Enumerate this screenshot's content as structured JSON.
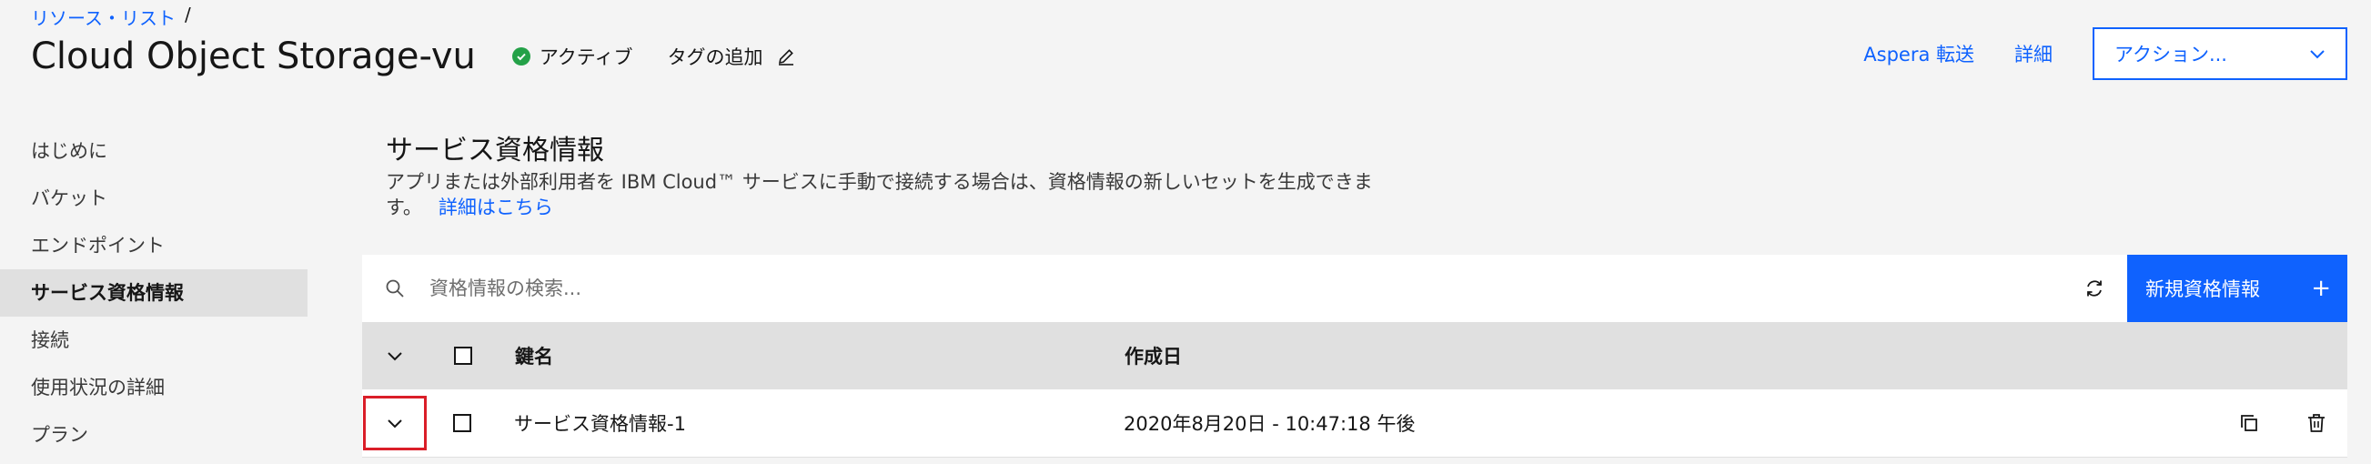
{
  "breadcrumb": {
    "link": "リソース・リスト",
    "separator": "/"
  },
  "header": {
    "title": "Cloud Object Storage-vu",
    "status": "アクティブ",
    "add_tag": "タグの追加",
    "aspera_link": "Aspera 転送",
    "details_link": "詳細",
    "actions_select": "アクション..."
  },
  "sidebar": {
    "items": [
      {
        "label": "はじめに"
      },
      {
        "label": "バケット"
      },
      {
        "label": "エンドポイント"
      },
      {
        "label": "サービス資格情報"
      },
      {
        "label": "接続"
      },
      {
        "label": "使用状況の詳細"
      },
      {
        "label": "プラン"
      }
    ],
    "active_index": 3
  },
  "section": {
    "title": "サービス資格情報",
    "description": "アプリまたは外部利用者を IBM Cloud™ サービスに手動で接続する場合は、資格情報の新しいセットを生成できます。",
    "more_link": "詳細はこちら"
  },
  "toolbar": {
    "search_placeholder": "資格情報の検索...",
    "new_button": "新規資格情報",
    "new_button_icon": "+"
  },
  "table": {
    "columns": {
      "name": "鍵名",
      "created": "作成日"
    },
    "rows": [
      {
        "name": "サービス資格情報-1",
        "created": "2020年8月20日 - 10:47:18 午後"
      }
    ]
  },
  "colors": {
    "accent": "#0f62fe",
    "status_green": "#24a148",
    "focus_red": "#da1e28"
  },
  "icons": [
    "check-circle-icon",
    "edit-icon",
    "chevron-down-icon",
    "search-icon",
    "refresh-icon",
    "copy-icon",
    "trash-icon"
  ]
}
